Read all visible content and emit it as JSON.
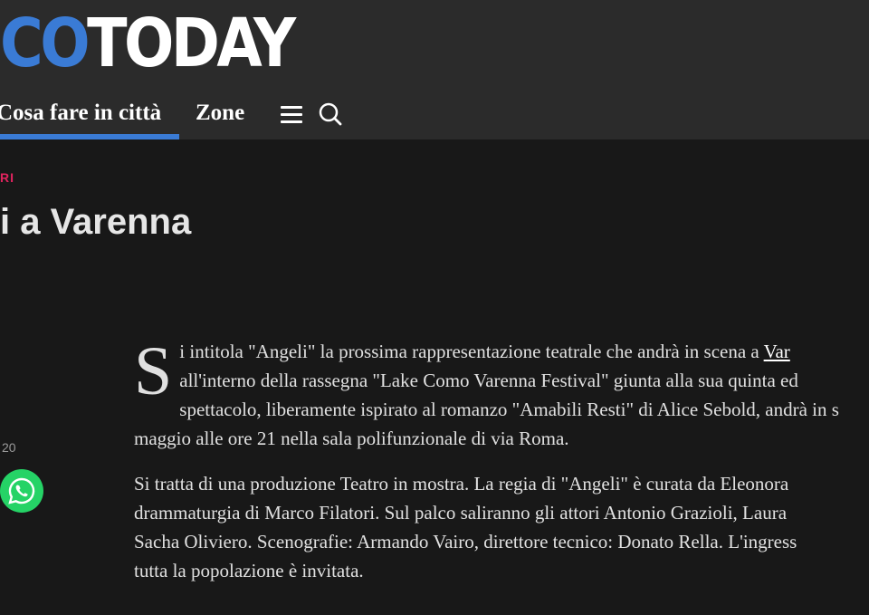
{
  "header": {
    "logo_part1": "CO",
    "logo_part2": "TODAY",
    "nav": {
      "active_item": "Cosa fare in città",
      "item2": "Zone"
    },
    "icons": {
      "menu": "hamburger-menu-icon",
      "search": "search-icon"
    }
  },
  "article": {
    "category": "RI",
    "title": "i a Varenna",
    "date": "20",
    "share_icon": "whatsapp-icon",
    "dropcap": "S",
    "p1_line1_text": "i intitola \"Angeli\" la prossima rappresentazione teatrale che andrà in scena a ",
    "p1_line1_link": "Var",
    "p1_line2": "all'interno della rassegna \"Lake Como Varenna Festival\" giunta alla sua quinta ed",
    "p1_line3": "spettacolo, liberamente ispirato al romanzo \"Amabili Resti\" di Alice Sebold, andrà in s",
    "p1_line4": "maggio alle ore 21 nella sala polifunzionale di via Roma.",
    "p2_line1": "Si tratta di una produzione Teatro in mostra. La regia di \"Angeli\" è curata da Eleonora",
    "p2_line2": "drammaturgia di Marco Filatori. Sul palco saliranno gli attori Antonio Grazioli, Laura",
    "p2_line3": "Sacha Oliviero. Scenografie: Armando Vairo, direttore tecnico: Donato Rella. L'ingress",
    "p2_line4": "tutta la popolazione è invitata."
  },
  "colors": {
    "brand_blue": "#3a7bd5",
    "category_pink": "#e0245e",
    "whatsapp_green": "#25d366",
    "header_bg": "#2b2b2b",
    "page_bg": "#181818"
  }
}
